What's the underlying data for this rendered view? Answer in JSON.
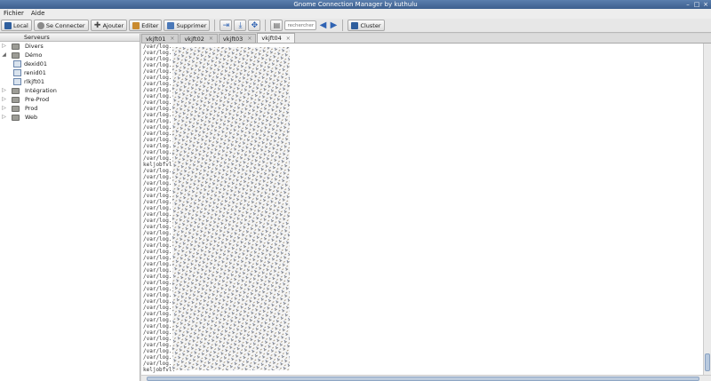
{
  "window": {
    "title": "Gnome Connection Manager by kuthulu"
  },
  "menu": {
    "file": "Fichier",
    "help": "Aide"
  },
  "toolbar": {
    "local": "Local",
    "connect": "Se Connecter",
    "add": "Ajouter",
    "edit": "Editer",
    "delete": "Supprimer",
    "search_placeholder": "rechercher",
    "cluster": "Cluster"
  },
  "sidebar": {
    "header": "Serveurs",
    "items": [
      {
        "label": "Divers"
      },
      {
        "label": "Démo"
      },
      {
        "label": "dexid01"
      },
      {
        "label": "renid01"
      },
      {
        "label": "rlkjft01"
      },
      {
        "label": "Intégration"
      },
      {
        "label": "Pre-Prod"
      },
      {
        "label": "Prod"
      },
      {
        "label": "Web"
      }
    ]
  },
  "tabs": [
    {
      "label": "vkjft01"
    },
    {
      "label": "vkjft02"
    },
    {
      "label": "vkjft03"
    },
    {
      "label": "vkjft04"
    }
  ],
  "terminal": {
    "log_line": "/var/log.",
    "prompt_line": "keljobfvl."
  }
}
